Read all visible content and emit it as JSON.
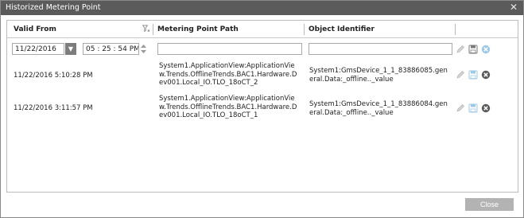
{
  "window": {
    "title": "Historized Metering Point",
    "close_glyph": "✕"
  },
  "columns": {
    "valid_from": "Valid From",
    "metering_point_path": "Metering Point Path",
    "object_identifier": "Object Identifier"
  },
  "filter_row": {
    "date_value": "11/22/2016",
    "time_value": "05 : 25 : 54  PM",
    "path_value": "",
    "object_value": ""
  },
  "rows": [
    {
      "valid_from": "11/22/2016 5:10:28 PM",
      "path": "System1.ApplicationView:ApplicationView.Trends.OfflineTrends.BAC1.Hardware.Dev001.Local_IO.TLO_18oCT_2",
      "object": "System1:GmsDevice_1_1_83886085.general.Data:_offline.._value"
    },
    {
      "valid_from": "11/22/2016 3:11:57 PM",
      "path": "System1.ApplicationView:ApplicationView.Trends.OfflineTrends.BAC1.Hardware.Dev001.Local_IO.TLO_18oCT_1",
      "object": "System1:GmsDevice_1_1_83886084.general.Data:_offline.._value"
    }
  ],
  "buttons": {
    "close": "Close"
  },
  "icons": {
    "edit": "pencil-icon",
    "save": "save-icon",
    "delete": "delete-icon",
    "filter": "filter-icon"
  },
  "colors": {
    "titlebar": "#5b5b5b",
    "close_button": "#b3b3b3",
    "disabled_icon_blue": "#9ec9e6",
    "dark_icon": "#5a5a5a"
  }
}
